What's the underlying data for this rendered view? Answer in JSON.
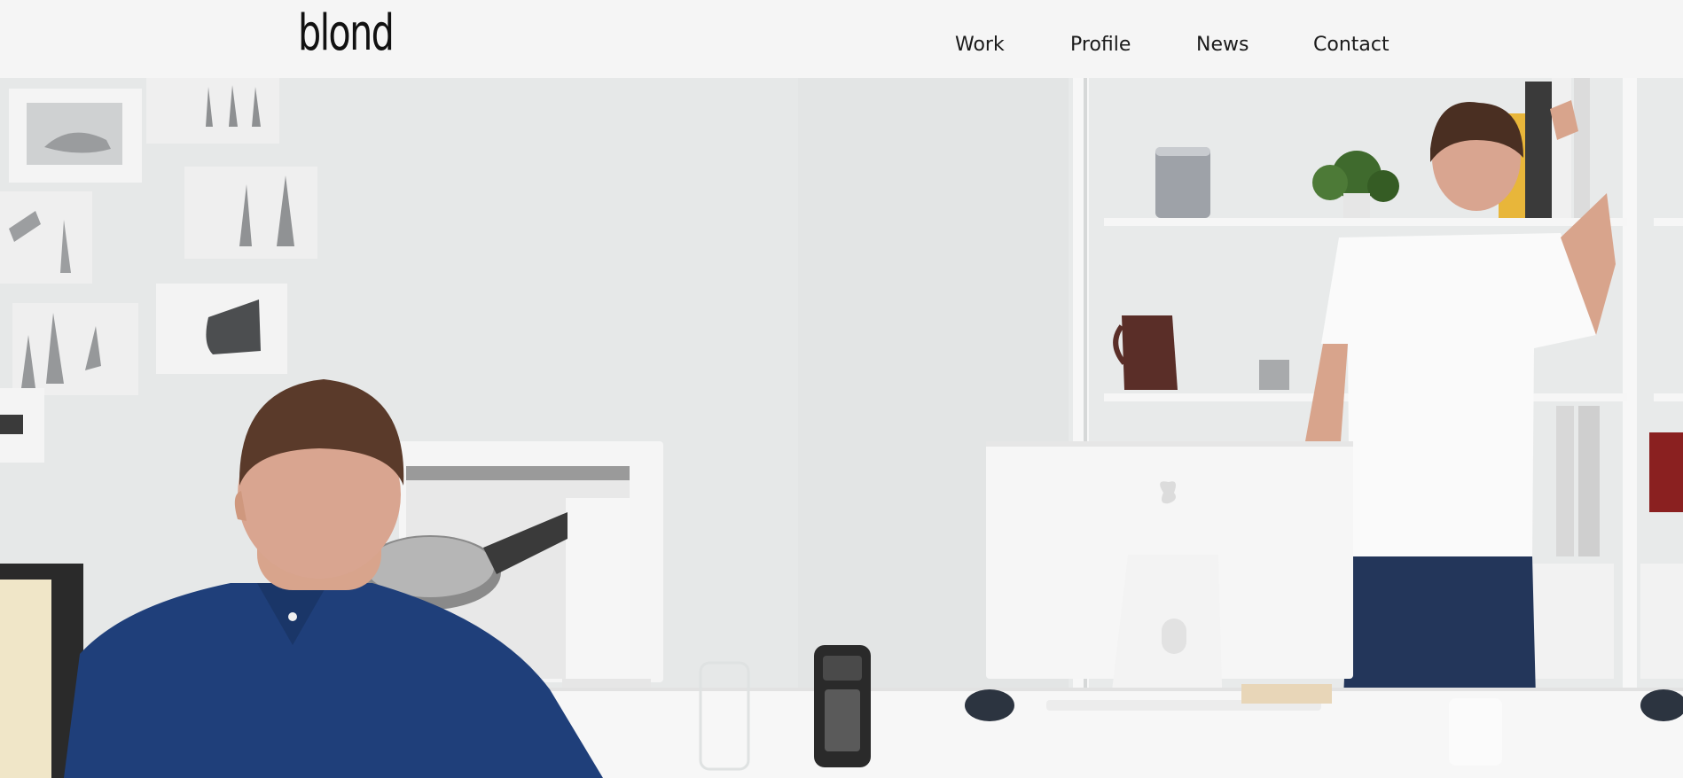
{
  "brand": {
    "logo_text": "blond"
  },
  "nav": {
    "items": [
      {
        "label": "Work"
      },
      {
        "label": "Profile"
      },
      {
        "label": "News"
      },
      {
        "label": "Contact"
      }
    ]
  },
  "hero": {
    "description": "",
    "colors": {
      "wall": "#e4e6e6",
      "shelf": "#f3f3f3",
      "desk": "#f7f7f7",
      "shirt_blue": "#1f3f7a",
      "jeans": "#23365a",
      "hair": "#5a3a2a",
      "skin": "#d8a48c",
      "accent_yellow": "#e8b63a"
    }
  }
}
